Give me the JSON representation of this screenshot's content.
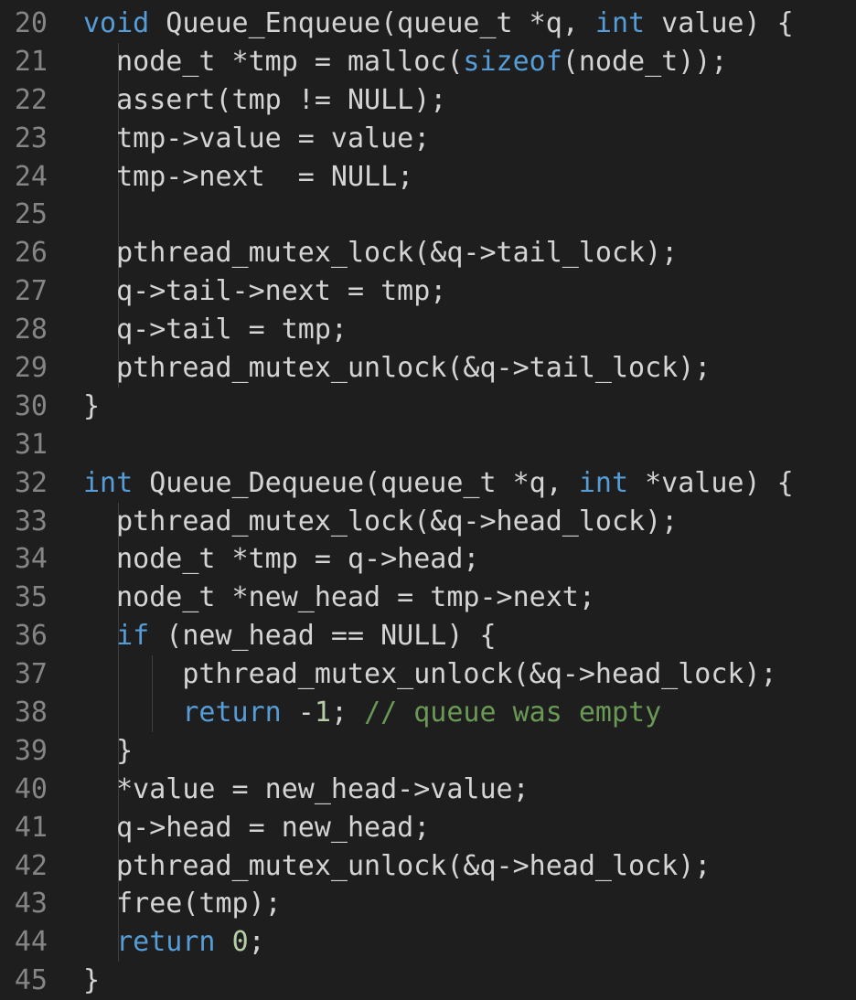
{
  "colors": {
    "background": "#1e1e1e",
    "foreground": "#d4d4d4",
    "line_number": "#858585",
    "keyword": "#569cd6",
    "number": "#b5cea8",
    "comment": "#6a9955",
    "indent_guide": "#404040"
  },
  "lines": [
    {
      "n": "20",
      "indent": 0,
      "tokens": [
        {
          "t": "void",
          "c": "kw"
        },
        {
          "t": " Queue_Enqueue(queue_t *q, ",
          "c": "plain"
        },
        {
          "t": "int",
          "c": "kw"
        },
        {
          "t": " value) {",
          "c": "plain"
        }
      ]
    },
    {
      "n": "21",
      "indent": 1,
      "tokens": [
        {
          "t": "  node_t *tmp = malloc(",
          "c": "plain"
        },
        {
          "t": "sizeof",
          "c": "kw"
        },
        {
          "t": "(node_t));",
          "c": "plain"
        }
      ]
    },
    {
      "n": "22",
      "indent": 1,
      "tokens": [
        {
          "t": "  assert(tmp != NULL);",
          "c": "plain"
        }
      ]
    },
    {
      "n": "23",
      "indent": 1,
      "tokens": [
        {
          "t": "  tmp->value = value;",
          "c": "plain"
        }
      ]
    },
    {
      "n": "24",
      "indent": 1,
      "tokens": [
        {
          "t": "  tmp->next  = NULL;",
          "c": "plain"
        }
      ]
    },
    {
      "n": "25",
      "indent": 1,
      "tokens": []
    },
    {
      "n": "26",
      "indent": 1,
      "tokens": [
        {
          "t": "  pthread_mutex_lock(&q->tail_lock);",
          "c": "plain"
        }
      ]
    },
    {
      "n": "27",
      "indent": 1,
      "tokens": [
        {
          "t": "  q->tail->next = tmp;",
          "c": "plain"
        }
      ]
    },
    {
      "n": "28",
      "indent": 1,
      "tokens": [
        {
          "t": "  q->tail = tmp;",
          "c": "plain"
        }
      ]
    },
    {
      "n": "29",
      "indent": 1,
      "tokens": [
        {
          "t": "  pthread_mutex_unlock(&q->tail_lock);",
          "c": "plain"
        }
      ]
    },
    {
      "n": "30",
      "indent": 0,
      "tokens": [
        {
          "t": "}",
          "c": "plain"
        }
      ]
    },
    {
      "n": "31",
      "indent": 0,
      "tokens": []
    },
    {
      "n": "32",
      "indent": 0,
      "tokens": [
        {
          "t": "int",
          "c": "kw"
        },
        {
          "t": " Queue_Dequeue(queue_t *q, ",
          "c": "plain"
        },
        {
          "t": "int",
          "c": "kw"
        },
        {
          "t": " *value) {",
          "c": "plain"
        }
      ]
    },
    {
      "n": "33",
      "indent": 1,
      "tokens": [
        {
          "t": "  pthread_mutex_lock(&q->head_lock);",
          "c": "plain"
        }
      ]
    },
    {
      "n": "34",
      "indent": 1,
      "tokens": [
        {
          "t": "  node_t *tmp = q->head;",
          "c": "plain"
        }
      ]
    },
    {
      "n": "35",
      "indent": 1,
      "tokens": [
        {
          "t": "  node_t *new_head = tmp->next;",
          "c": "plain"
        }
      ]
    },
    {
      "n": "36",
      "indent": 1,
      "tokens": [
        {
          "t": "  ",
          "c": "plain"
        },
        {
          "t": "if",
          "c": "kw"
        },
        {
          "t": " (new_head == NULL) {",
          "c": "plain"
        }
      ]
    },
    {
      "n": "37",
      "indent": 3,
      "tokens": [
        {
          "t": "      pthread_mutex_unlock(&q->head_lock);",
          "c": "plain"
        }
      ]
    },
    {
      "n": "38",
      "indent": 3,
      "tokens": [
        {
          "t": "      ",
          "c": "plain"
        },
        {
          "t": "return",
          "c": "kw"
        },
        {
          "t": " -",
          "c": "plain"
        },
        {
          "t": "1",
          "c": "num"
        },
        {
          "t": "; ",
          "c": "plain"
        },
        {
          "t": "// queue was empty",
          "c": "cm"
        }
      ]
    },
    {
      "n": "39",
      "indent": 1,
      "tokens": [
        {
          "t": "  }",
          "c": "plain"
        }
      ]
    },
    {
      "n": "40",
      "indent": 1,
      "tokens": [
        {
          "t": "  *value = new_head->value;",
          "c": "plain"
        }
      ]
    },
    {
      "n": "41",
      "indent": 1,
      "tokens": [
        {
          "t": "  q->head = new_head;",
          "c": "plain"
        }
      ]
    },
    {
      "n": "42",
      "indent": 1,
      "tokens": [
        {
          "t": "  pthread_mutex_unlock(&q->head_lock);",
          "c": "plain"
        }
      ]
    },
    {
      "n": "43",
      "indent": 1,
      "tokens": [
        {
          "t": "  free(tmp);",
          "c": "plain"
        }
      ]
    },
    {
      "n": "44",
      "indent": 1,
      "tokens": [
        {
          "t": "  ",
          "c": "plain"
        },
        {
          "t": "return",
          "c": "kw"
        },
        {
          "t": " ",
          "c": "plain"
        },
        {
          "t": "0",
          "c": "num"
        },
        {
          "t": ";",
          "c": "plain"
        }
      ]
    },
    {
      "n": "45",
      "indent": 0,
      "tokens": [
        {
          "t": "}",
          "c": "plain"
        }
      ]
    }
  ]
}
